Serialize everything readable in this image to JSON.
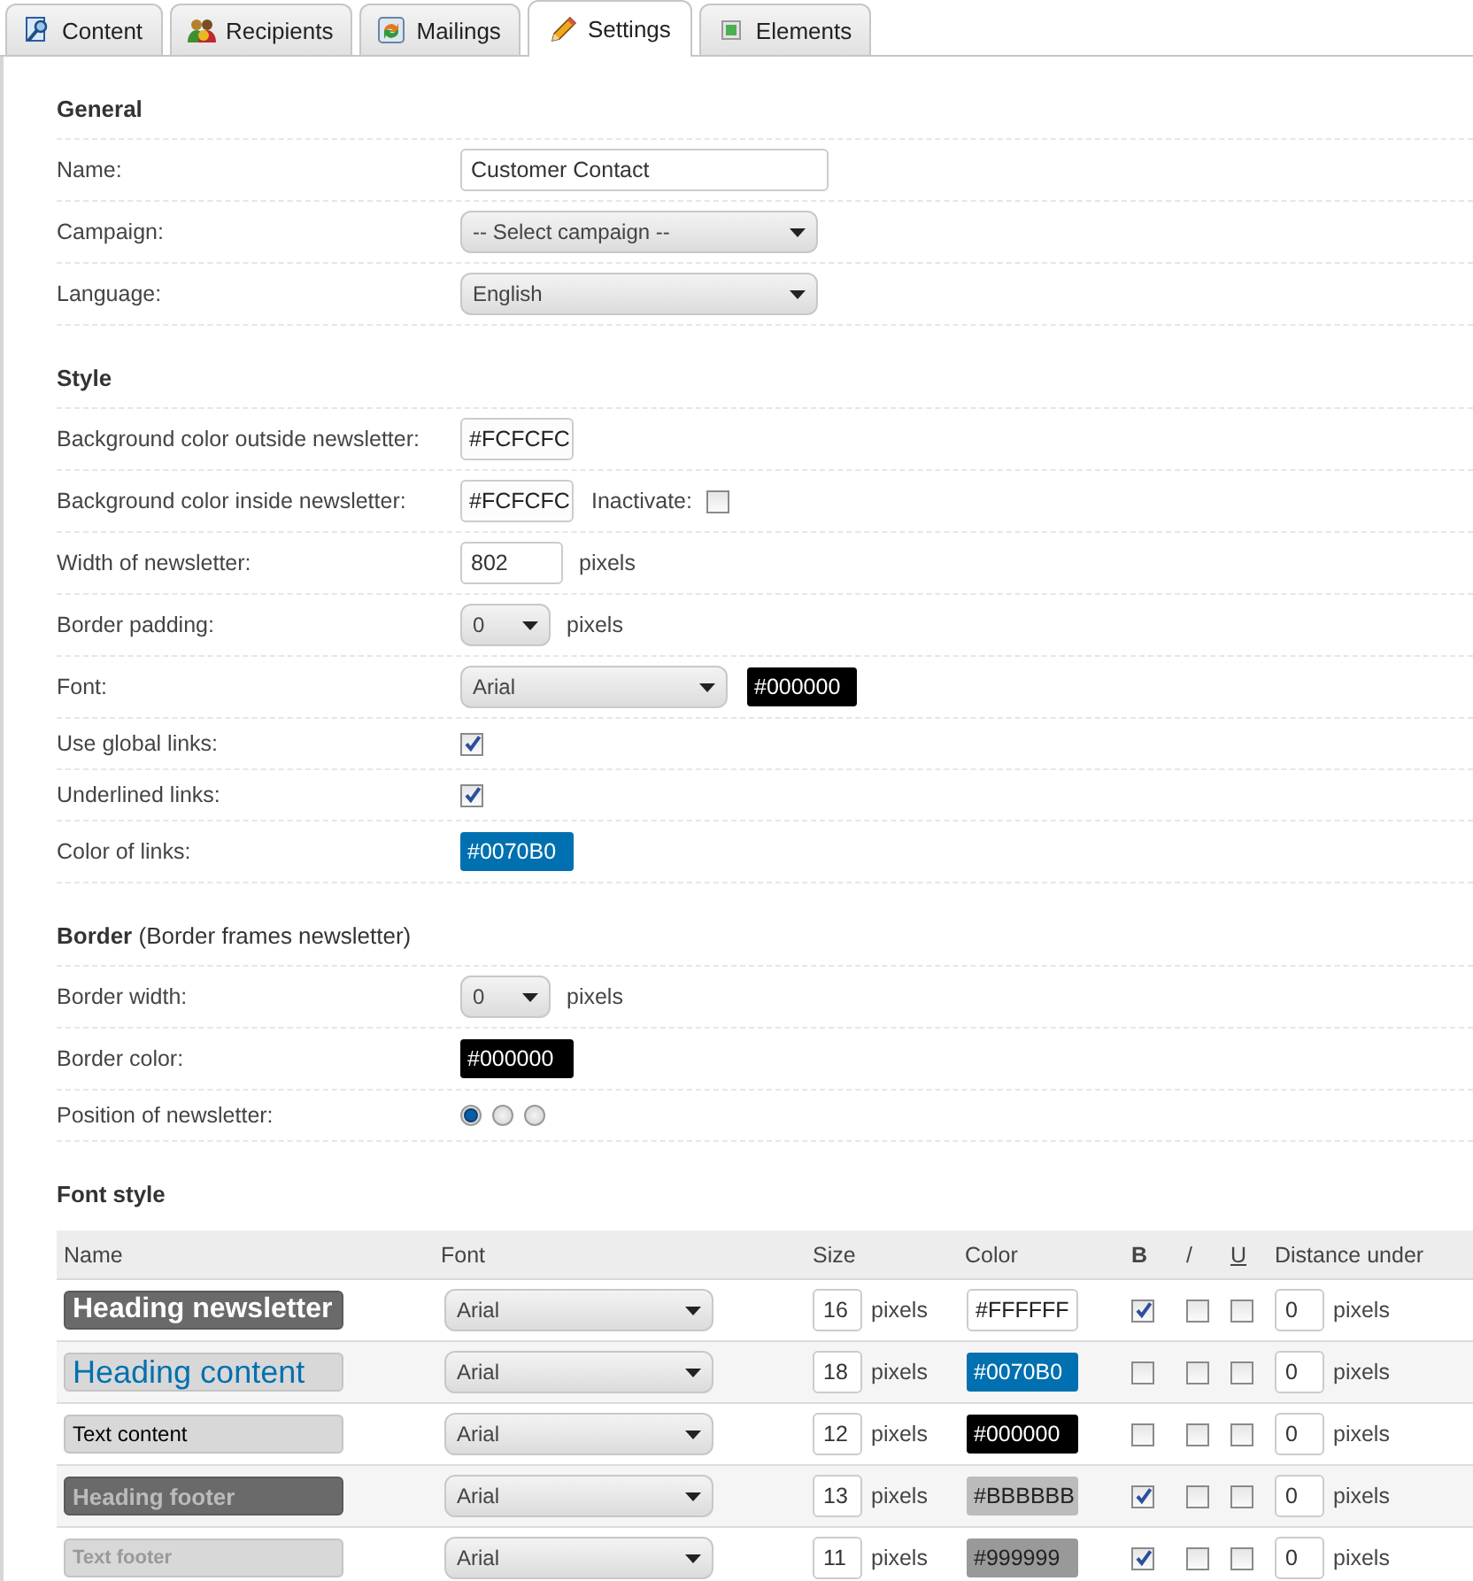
{
  "tabs": [
    {
      "label": "Content",
      "selected": false
    },
    {
      "label": "Recipients",
      "selected": false
    },
    {
      "label": "Mailings",
      "selected": false
    },
    {
      "label": "Settings",
      "selected": true
    },
    {
      "label": "Elements",
      "selected": false
    }
  ],
  "sections": [
    {
      "title": "General",
      "rows": [
        {
          "kind": "input",
          "label": "Name:",
          "value": "Customer Contact"
        },
        {
          "kind": "select",
          "label": "Campaign:",
          "value": "-- Select campaign --"
        },
        {
          "kind": "select",
          "label": "Language:",
          "value": "English"
        }
      ]
    },
    {
      "title": "Style",
      "rows": [
        {
          "kind": "color",
          "label": "Background color outside newsletter:",
          "value": "#FCFCFC",
          "color": "#fcfcfc"
        },
        {
          "kind": "color",
          "label": "Background color inside newsletter:",
          "value": "#FCFCFC",
          "color": "#fcfcfc",
          "option": {
            "label": "Inactivate:",
            "checked": false
          }
        },
        {
          "kind": "input",
          "label": "Width of newsletter:",
          "value": "802",
          "unit": "pixels"
        },
        {
          "kind": "select",
          "label": "Border padding:",
          "value": "0",
          "unit": "pixels"
        },
        {
          "kind": "select",
          "label": "Font:",
          "value": "Arial",
          "swatch": {
            "value": "#000000",
            "color": "#000000"
          }
        },
        {
          "kind": "checkbox",
          "label": "Use global links:",
          "checked": true
        },
        {
          "kind": "checkbox",
          "label": "Underlined links:",
          "checked": true
        },
        {
          "kind": "color",
          "label": "Color of links:",
          "value": "#0070B0",
          "color": "#0070b0"
        }
      ]
    },
    {
      "title": "Border",
      "note": "(Border frames newsletter)",
      "rows": [
        {
          "kind": "select",
          "label": "Border width:",
          "value": "0",
          "unit": "pixels"
        },
        {
          "kind": "color",
          "label": "Border color:",
          "value": "#000000",
          "color": "#000000"
        },
        {
          "kind": "radio",
          "label": "Position of newsletter:",
          "options": [
            {
              "selected": true
            },
            {
              "selected": false
            },
            {
              "selected": false
            }
          ]
        }
      ]
    }
  ],
  "font_style": {
    "title": "Font style",
    "columns": [
      "Name",
      "Font",
      "Size",
      "Color",
      "B",
      "/",
      "U",
      "Distance under"
    ],
    "rows": [
      {
        "name": "Heading newsletter",
        "font": "Arial",
        "size": "16",
        "size_unit": "pixels",
        "color_value": "#FFFFFF",
        "color": "#ffffff",
        "bold": true,
        "italic": false,
        "underline": false,
        "distance": "0",
        "distance_unit": "pixels"
      },
      {
        "name": "Heading content",
        "font": "Arial",
        "size": "18",
        "size_unit": "pixels",
        "color_value": "#0070B0",
        "color": "#0070b0",
        "bold": false,
        "italic": false,
        "underline": false,
        "distance": "0",
        "distance_unit": "pixels"
      },
      {
        "name": "Text content",
        "font": "Arial",
        "size": "12",
        "size_unit": "pixels",
        "color_value": "#000000",
        "color": "#000000",
        "bold": false,
        "italic": false,
        "underline": false,
        "distance": "0",
        "distance_unit": "pixels"
      },
      {
        "name": "Heading footer",
        "font": "Arial",
        "size": "13",
        "size_unit": "pixels",
        "color_value": "#BBBBBB",
        "color": "#bbbbbb",
        "bold": true,
        "italic": false,
        "underline": false,
        "distance": "0",
        "distance_unit": "pixels"
      },
      {
        "name": "Text footer",
        "font": "Arial",
        "size": "11",
        "size_unit": "pixels",
        "color_value": "#999999",
        "color": "#999999",
        "bold": true,
        "italic": false,
        "underline": false,
        "distance": "0",
        "distance_unit": "pixels"
      }
    ]
  }
}
